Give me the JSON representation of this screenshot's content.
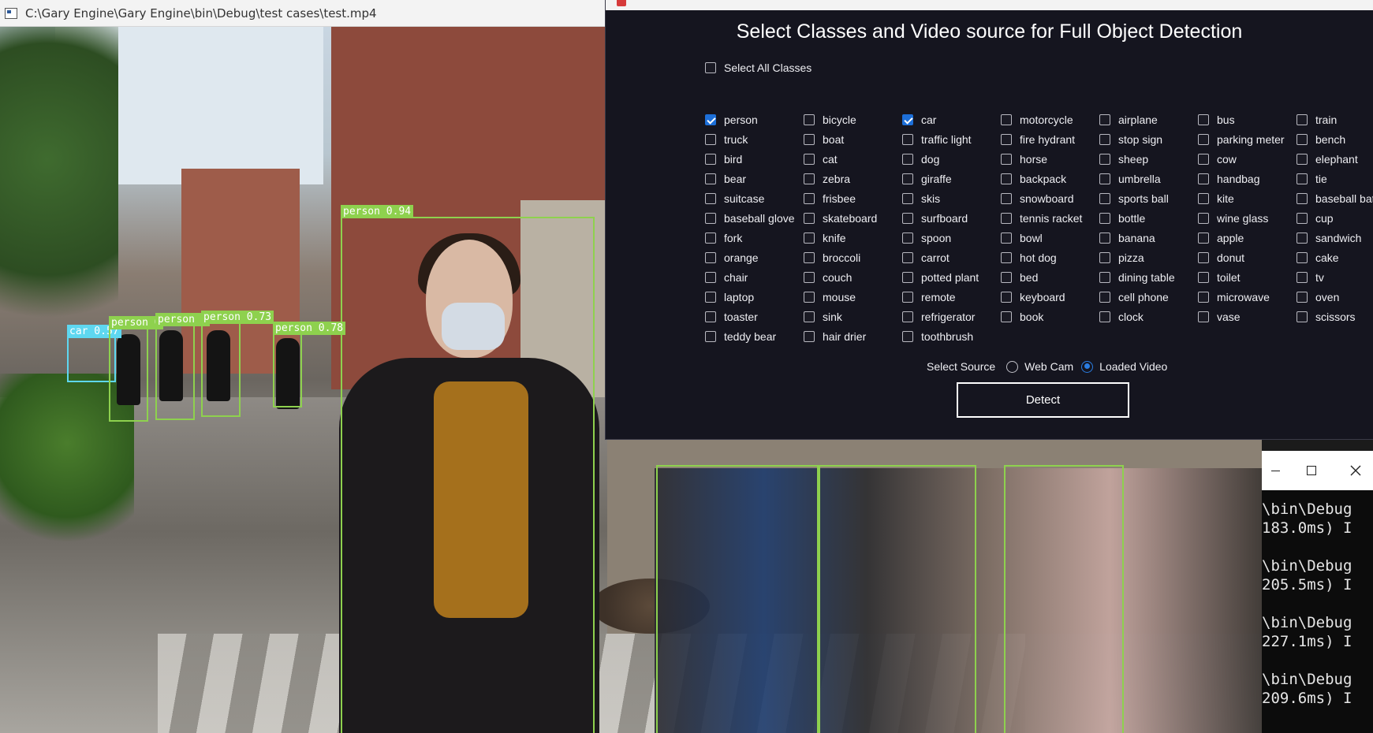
{
  "video_window": {
    "title": "C:\\Gary Engine\\Gary Engine\\bin\\Debug\\test cases\\test.mp4",
    "detections": [
      {
        "label": "person 0.94",
        "class": "person"
      },
      {
        "label": "car 0.57",
        "class": "car"
      },
      {
        "label": "person 0",
        "class": "person"
      },
      {
        "label": "person 0",
        "class": "person"
      },
      {
        "label": "person 0.73",
        "class": "person"
      },
      {
        "label": "person 0.78",
        "class": "person"
      }
    ]
  },
  "dialog": {
    "heading": "Select Classes and Video source for Full Object Detection",
    "select_all_label": "Select All Classes",
    "select_all_checked": false,
    "classes": [
      {
        "label": "person",
        "checked": true
      },
      {
        "label": "bicycle",
        "checked": false
      },
      {
        "label": "car",
        "checked": true
      },
      {
        "label": "motorcycle",
        "checked": false
      },
      {
        "label": "airplane",
        "checked": false
      },
      {
        "label": "bus",
        "checked": false
      },
      {
        "label": "train",
        "checked": false
      },
      {
        "label": "truck",
        "checked": false
      },
      {
        "label": "boat",
        "checked": false
      },
      {
        "label": "traffic light",
        "checked": false
      },
      {
        "label": "fire hydrant",
        "checked": false
      },
      {
        "label": "stop sign",
        "checked": false
      },
      {
        "label": "parking meter",
        "checked": false
      },
      {
        "label": "bench",
        "checked": false
      },
      {
        "label": "bird",
        "checked": false
      },
      {
        "label": "cat",
        "checked": false
      },
      {
        "label": "dog",
        "checked": false
      },
      {
        "label": "horse",
        "checked": false
      },
      {
        "label": "sheep",
        "checked": false
      },
      {
        "label": "cow",
        "checked": false
      },
      {
        "label": "elephant",
        "checked": false
      },
      {
        "label": "bear",
        "checked": false
      },
      {
        "label": "zebra",
        "checked": false
      },
      {
        "label": "giraffe",
        "checked": false
      },
      {
        "label": "backpack",
        "checked": false
      },
      {
        "label": "umbrella",
        "checked": false
      },
      {
        "label": "handbag",
        "checked": false
      },
      {
        "label": "tie",
        "checked": false
      },
      {
        "label": "suitcase",
        "checked": false
      },
      {
        "label": "frisbee",
        "checked": false
      },
      {
        "label": "skis",
        "checked": false
      },
      {
        "label": "snowboard",
        "checked": false
      },
      {
        "label": "sports ball",
        "checked": false
      },
      {
        "label": "kite",
        "checked": false
      },
      {
        "label": "baseball bat",
        "checked": false
      },
      {
        "label": "baseball glove",
        "checked": false
      },
      {
        "label": "skateboard",
        "checked": false
      },
      {
        "label": "surfboard",
        "checked": false
      },
      {
        "label": "tennis racket",
        "checked": false
      },
      {
        "label": "bottle",
        "checked": false
      },
      {
        "label": "wine glass",
        "checked": false
      },
      {
        "label": "cup",
        "checked": false
      },
      {
        "label": "fork",
        "checked": false
      },
      {
        "label": "knife",
        "checked": false
      },
      {
        "label": "spoon",
        "checked": false
      },
      {
        "label": "bowl",
        "checked": false
      },
      {
        "label": "banana",
        "checked": false
      },
      {
        "label": "apple",
        "checked": false
      },
      {
        "label": "sandwich",
        "checked": false
      },
      {
        "label": "orange",
        "checked": false
      },
      {
        "label": "broccoli",
        "checked": false
      },
      {
        "label": "carrot",
        "checked": false
      },
      {
        "label": "hot dog",
        "checked": false
      },
      {
        "label": "pizza",
        "checked": false
      },
      {
        "label": "donut",
        "checked": false
      },
      {
        "label": "cake",
        "checked": false
      },
      {
        "label": "chair",
        "checked": false
      },
      {
        "label": "couch",
        "checked": false
      },
      {
        "label": "potted plant",
        "checked": false
      },
      {
        "label": "bed",
        "checked": false
      },
      {
        "label": "dining table",
        "checked": false
      },
      {
        "label": "toilet",
        "checked": false
      },
      {
        "label": "tv",
        "checked": false
      },
      {
        "label": "laptop",
        "checked": false
      },
      {
        "label": "mouse",
        "checked": false
      },
      {
        "label": "remote",
        "checked": false
      },
      {
        "label": "keyboard",
        "checked": false
      },
      {
        "label": "cell phone",
        "checked": false
      },
      {
        "label": "microwave",
        "checked": false
      },
      {
        "label": "oven",
        "checked": false
      },
      {
        "label": "toaster",
        "checked": false
      },
      {
        "label": "sink",
        "checked": false
      },
      {
        "label": "refrigerator",
        "checked": false
      },
      {
        "label": "book",
        "checked": false
      },
      {
        "label": "clock",
        "checked": false
      },
      {
        "label": "vase",
        "checked": false
      },
      {
        "label": "scissors",
        "checked": false
      },
      {
        "label": "teddy bear",
        "checked": false
      },
      {
        "label": "hair drier",
        "checked": false
      },
      {
        "label": "toothbrush",
        "checked": false
      }
    ],
    "source_label": "Select Source",
    "sources": [
      {
        "label": "Web Cam",
        "selected": false
      },
      {
        "label": "Loaded Video",
        "selected": true
      }
    ],
    "detect_button": "Detect"
  },
  "console": {
    "lines": [
      "\\bin\\Debug",
      "183.0ms) I",
      "",
      "\\bin\\Debug",
      "205.5ms) I",
      "",
      "\\bin\\Debug",
      "227.1ms) I",
      "",
      "\\bin\\Debug",
      "209.6ms) I"
    ]
  },
  "colors": {
    "dialog_bg": "#15151f",
    "checkbox_checked": "#1d6fd8",
    "person_box": "#8ed14e",
    "car_box": "#5ed7f0"
  }
}
